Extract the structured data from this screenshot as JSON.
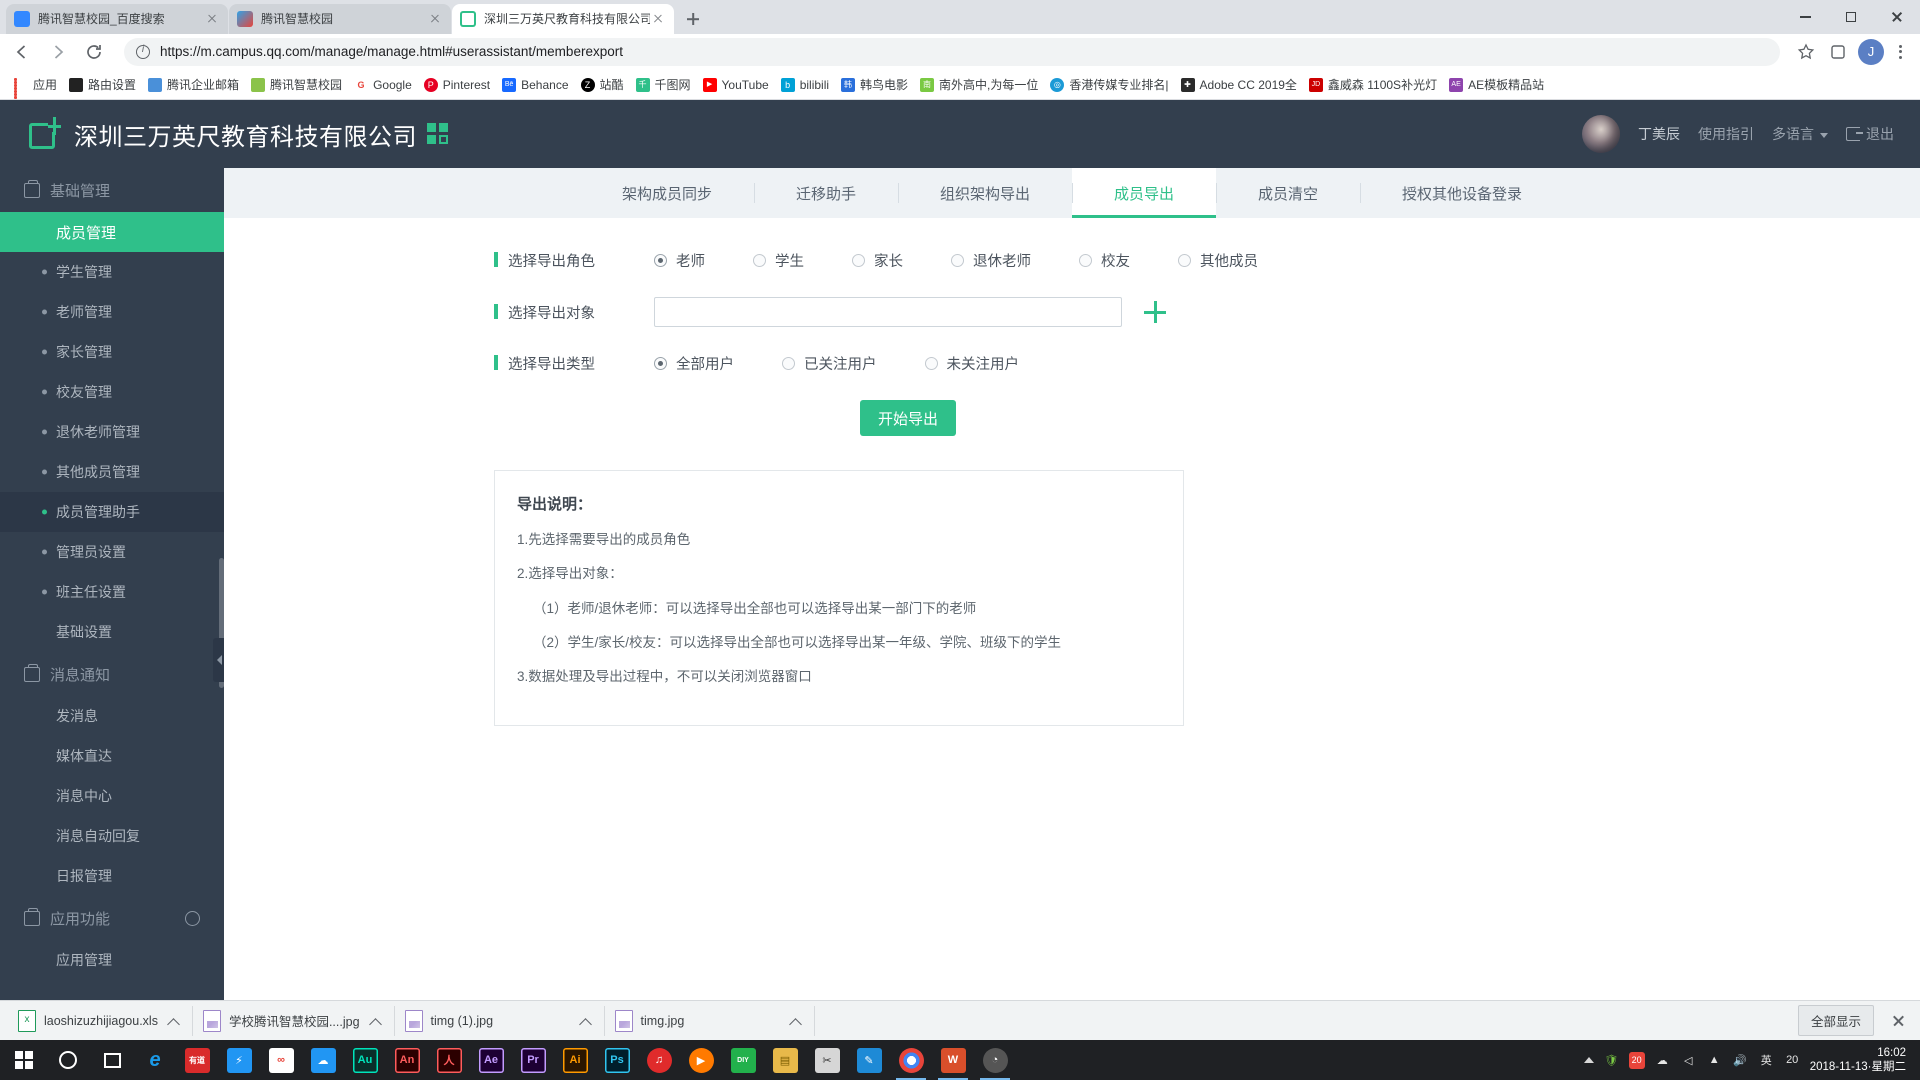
{
  "browser": {
    "tabs": [
      {
        "title": "腾讯智慧校园_百度搜索",
        "favicon": "baidu-icon",
        "color": "#3388ff",
        "active": false
      },
      {
        "title": "腾讯智慧校园",
        "favicon": "campus-icon",
        "color": "#f0f0f0",
        "active": false
      },
      {
        "title": "深圳三万英尺教育科技有限公司_",
        "favicon": "site-icon",
        "color": "#ffffff",
        "active": true
      }
    ],
    "newtab_label": "+",
    "url": "https://m.campus.qq.com/manage/manage.html#userassistant/memberexport",
    "profile_initial": "J",
    "window_controls": {
      "minimize": "minimize-icon",
      "maximize": "maximize-icon",
      "close": "close-icon"
    },
    "bookmarks": [
      {
        "label": "应用",
        "color": "#e8443a",
        "glyph": ""
      },
      {
        "label": "路由设置",
        "color": "#222222",
        "glyph": ""
      },
      {
        "label": "腾讯企业邮箱",
        "color": "#4a90d9",
        "glyph": ""
      },
      {
        "label": "腾讯智慧校园",
        "color": "#8bc34a",
        "glyph": ""
      },
      {
        "label": "Google",
        "color": "#ffffff",
        "glyph": "G"
      },
      {
        "label": "Pinterest",
        "color": "#e60023",
        "glyph": "P"
      },
      {
        "label": "Behance",
        "color": "#1769ff",
        "glyph": "Bē"
      },
      {
        "label": "站酷",
        "color": "#000000",
        "glyph": "Z"
      },
      {
        "label": "千图网",
        "color": "#2fc08a",
        "glyph": "千"
      },
      {
        "label": "YouTube",
        "color": "#ff0000",
        "glyph": "▶"
      },
      {
        "label": "bilibili",
        "color": "#00a1d6",
        "glyph": "b"
      },
      {
        "label": "韩鸟电影",
        "color": "#2a6fdb",
        "glyph": "韩"
      },
      {
        "label": "南外高中,为每一位",
        "color": "#7ac943",
        "glyph": "南"
      },
      {
        "label": "香港传媒专业排名|",
        "color": "#1b9ad6",
        "glyph": "◎"
      },
      {
        "label": "Adobe CC 2019全",
        "color": "#2b2b2b",
        "glyph": "✚"
      },
      {
        "label": "鑫威森 1100S补光灯",
        "color": "#cc0000",
        "glyph": "JD"
      },
      {
        "label": "AE模板精品站",
        "color": "#8e44ad",
        "glyph": "AE"
      }
    ]
  },
  "app": {
    "company_name": "深圳三万英尺教育科技有限公司",
    "qr_icon": "qr-code-icon",
    "logo_icon": "campus-logo-icon",
    "user_name": "丁美辰",
    "guide_label": "使用指引",
    "language_label": "多语言",
    "logout_label": "退出"
  },
  "sidebar": {
    "groups": [
      {
        "title": "基础管理",
        "icon": "briefcase-icon",
        "has_gear": false,
        "items": [
          {
            "label": "成员管理",
            "type": "active-parent"
          },
          {
            "label": "学生管理",
            "type": "sub"
          },
          {
            "label": "老师管理",
            "type": "sub"
          },
          {
            "label": "家长管理",
            "type": "sub"
          },
          {
            "label": "校友管理",
            "type": "sub"
          },
          {
            "label": "退休老师管理",
            "type": "sub"
          },
          {
            "label": "其他成员管理",
            "type": "sub"
          },
          {
            "label": "成员管理助手",
            "type": "sub-current"
          },
          {
            "label": "管理员设置",
            "type": "sub"
          },
          {
            "label": "班主任设置",
            "type": "sub"
          },
          {
            "label": "基础设置",
            "type": "plain"
          }
        ]
      },
      {
        "title": "消息通知",
        "icon": "message-icon",
        "has_gear": false,
        "items": [
          {
            "label": "发消息",
            "type": "plain"
          },
          {
            "label": "媒体直达",
            "type": "plain"
          },
          {
            "label": "消息中心",
            "type": "plain"
          },
          {
            "label": "消息自动回复",
            "type": "plain"
          },
          {
            "label": "日报管理",
            "type": "plain"
          }
        ]
      },
      {
        "title": "应用功能",
        "icon": "apps-icon",
        "has_gear": true,
        "items": [
          {
            "label": "应用管理",
            "type": "plain"
          }
        ]
      }
    ]
  },
  "main": {
    "tabs": [
      {
        "label": "架构成员同步",
        "active": false
      },
      {
        "label": "迁移助手",
        "active": false
      },
      {
        "label": "组织架构导出",
        "active": false
      },
      {
        "label": "成员导出",
        "active": true
      },
      {
        "label": "成员清空",
        "active": false
      },
      {
        "label": "授权其他设备登录",
        "active": false
      }
    ],
    "form": {
      "role_label": "选择导出角色",
      "roles": [
        {
          "label": "老师",
          "checked": true
        },
        {
          "label": "学生",
          "checked": false
        },
        {
          "label": "家长",
          "checked": false
        },
        {
          "label": "退休老师",
          "checked": false
        },
        {
          "label": "校友",
          "checked": false
        },
        {
          "label": "其他成员",
          "checked": false
        }
      ],
      "target_label": "选择导出对象",
      "target_value": "",
      "target_placeholder": "",
      "add_icon": "plus-icon",
      "type_label": "选择导出类型",
      "types": [
        {
          "label": "全部用户",
          "checked": true
        },
        {
          "label": "已关注用户",
          "checked": false
        },
        {
          "label": "未关注用户",
          "checked": false
        }
      ],
      "submit_label": "开始导出"
    },
    "notes": {
      "title": "导出说明：",
      "lines": [
        {
          "text": "1.先选择需要导出的成员角色",
          "indent": false
        },
        {
          "text": "2.选择导出对象：",
          "indent": false
        },
        {
          "text": "（1）老师/退休老师：可以选择导出全部也可以选择导出某一部门下的老师",
          "indent": true
        },
        {
          "text": "（2）学生/家长/校友：可以选择导出全部也可以选择导出某一年级、学院、班级下的学生",
          "indent": true
        },
        {
          "text": "3.数据处理及导出过程中，不可以关闭浏览器窗口",
          "indent": false
        }
      ]
    }
  },
  "downloads": {
    "items": [
      {
        "name": "laoshizuzhijiagou.xls",
        "kind": "xls"
      },
      {
        "name": "学校腾讯智慧校园....jpg",
        "kind": "img"
      },
      {
        "name": "timg (1).jpg",
        "kind": "img"
      },
      {
        "name": "timg.jpg",
        "kind": "img"
      }
    ],
    "show_all_label": "全部显示",
    "close_icon": "close-icon"
  },
  "taskbar": {
    "start_icon": "windows-start-icon",
    "search_icon": "search-circle-icon",
    "taskview_icon": "task-view-icon",
    "apps": [
      {
        "name": "Internet Explorer",
        "glyph": "e",
        "color": "#1a6fc4",
        "running": false
      },
      {
        "name": "有道",
        "glyph": "有道",
        "color": "#d92b2b",
        "running": false
      },
      {
        "name": "迅雷",
        "glyph": "⚡",
        "color": "#2196f3",
        "running": false
      },
      {
        "name": "360",
        "glyph": "∞",
        "color": "#ffffff",
        "running": false
      },
      {
        "name": "百度网盘",
        "glyph": "☁",
        "color": "#2196f3",
        "running": false
      },
      {
        "name": "Audition",
        "glyph": "Au",
        "color": "#00a08a",
        "running": false
      },
      {
        "name": "Animate",
        "glyph": "An",
        "color": "#c0392b",
        "running": false
      },
      {
        "name": "Acrobat",
        "glyph": "人",
        "color": "#9b1b1b",
        "running": false
      },
      {
        "name": "After Effects",
        "glyph": "Ae",
        "color": "#5b2a86",
        "running": false
      },
      {
        "name": "Premiere",
        "glyph": "Pr",
        "color": "#6a2ba3",
        "running": false
      },
      {
        "name": "Illustrator",
        "glyph": "Ai",
        "color": "#7a4a07",
        "running": false
      },
      {
        "name": "Photoshop",
        "glyph": "Ps",
        "color": "#0b5a7a",
        "running": false
      },
      {
        "name": "网易云音乐",
        "glyph": "♫",
        "color": "#e02b2b",
        "running": false
      },
      {
        "name": "迅雷影音",
        "glyph": "▶",
        "color": "#ff7a00",
        "running": false
      },
      {
        "name": "DIY",
        "glyph": "DIY",
        "color": "#22b14c",
        "running": false
      },
      {
        "name": "文件资源管理器",
        "glyph": "▤",
        "color": "#e8b94a",
        "running": false
      },
      {
        "name": "截图工具",
        "glyph": "✂",
        "color": "#8a2be2",
        "running": false
      },
      {
        "name": "画图",
        "glyph": "🎨",
        "color": "#1e8ad6",
        "running": false
      },
      {
        "name": "Chrome",
        "glyph": "◉",
        "color": "#e8443a",
        "running": true
      },
      {
        "name": "WPS",
        "glyph": "W",
        "color": "#d94f2b",
        "running": true
      },
      {
        "name": "其他",
        "glyph": "◔",
        "color": "#555555",
        "running": true
      }
    ],
    "tray": [
      "^",
      "盾",
      "网",
      "A",
      "☁",
      "🔊",
      "英"
    ],
    "ime_label": "英",
    "tray_badge": "20",
    "clock_time": "16:02",
    "clock_date": "2018-11-13·星期二"
  }
}
